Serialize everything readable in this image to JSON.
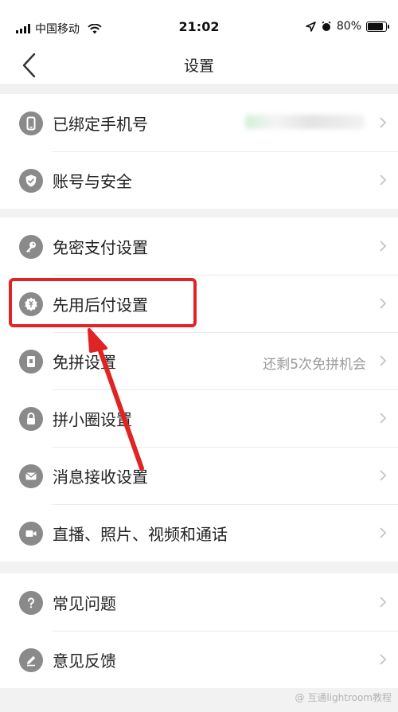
{
  "status_bar": {
    "carrier": "中国移动",
    "time": "21:02",
    "battery": "80%",
    "battery_level": 0.8
  },
  "nav": {
    "title": "设置"
  },
  "groups": [
    {
      "items": [
        {
          "label": "已绑定手机号",
          "icon": "phone-icon",
          "value": ""
        },
        {
          "label": "账号与安全",
          "icon": "shield-icon"
        }
      ]
    },
    {
      "items": [
        {
          "label": "免密支付设置",
          "icon": "key-icon"
        },
        {
          "label": "先用后付设置",
          "icon": "pay-later-icon"
        },
        {
          "label": "免拼设置",
          "icon": "group-buy-icon",
          "value": "还剩5次免拼机会"
        },
        {
          "label": "拼小圈设置",
          "icon": "lock-icon"
        },
        {
          "label": "消息接收设置",
          "icon": "mail-icon"
        },
        {
          "label": "直播、照片、视频和通话",
          "icon": "video-icon"
        }
      ]
    },
    {
      "items": [
        {
          "label": "常见问题",
          "icon": "question-icon"
        },
        {
          "label": "意见反馈",
          "icon": "pen-icon"
        }
      ]
    }
  ],
  "annotation_color": "#e02424",
  "watermark": "@ 互通lightroom教程"
}
